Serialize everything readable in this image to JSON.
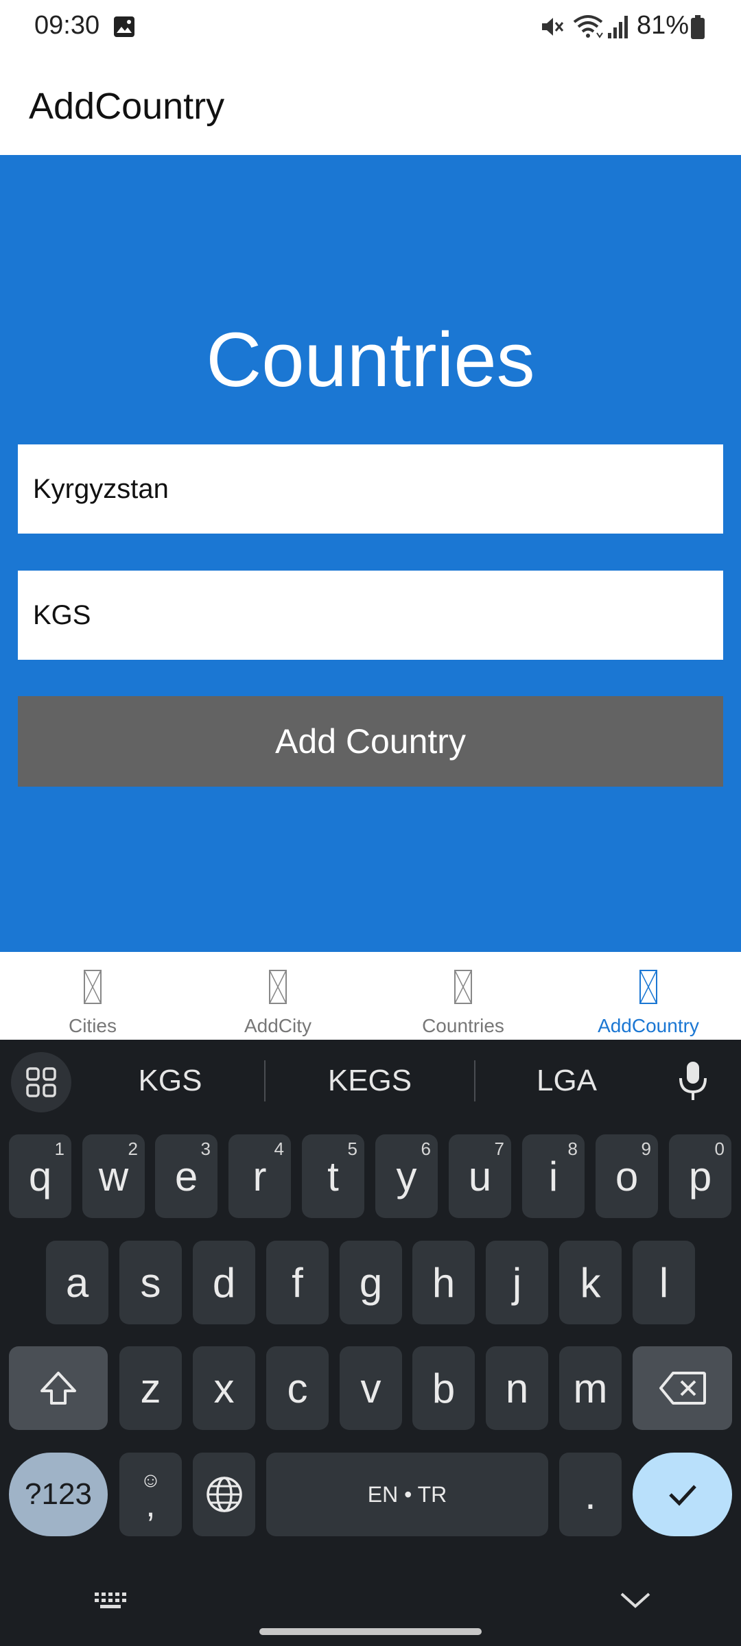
{
  "status_bar": {
    "time": "09:30",
    "battery": "81%",
    "icons": [
      "gallery-icon",
      "mute-icon",
      "wifi-icon",
      "signal-icon",
      "battery-icon"
    ]
  },
  "app_bar": {
    "title": "AddCountry"
  },
  "main": {
    "heading": "Countries",
    "country_name_value": "Kyrgyzstan",
    "currency_value": "KGS",
    "add_button_label": "Add Country"
  },
  "bottom_nav": {
    "tabs": [
      {
        "label": "Cities",
        "active": false
      },
      {
        "label": "AddCity",
        "active": false
      },
      {
        "label": "Countries",
        "active": false
      },
      {
        "label": "AddCountry",
        "active": true
      }
    ]
  },
  "keyboard": {
    "suggestions": [
      "KGS",
      "KEGS",
      "LGA"
    ],
    "row1": [
      {
        "key": "q",
        "hint": "1"
      },
      {
        "key": "w",
        "hint": "2"
      },
      {
        "key": "e",
        "hint": "3"
      },
      {
        "key": "r",
        "hint": "4"
      },
      {
        "key": "t",
        "hint": "5"
      },
      {
        "key": "y",
        "hint": "6"
      },
      {
        "key": "u",
        "hint": "7"
      },
      {
        "key": "i",
        "hint": "8"
      },
      {
        "key": "o",
        "hint": "9"
      },
      {
        "key": "p",
        "hint": "0"
      }
    ],
    "row2": [
      "a",
      "s",
      "d",
      "f",
      "g",
      "h",
      "j",
      "k",
      "l"
    ],
    "row3": [
      "z",
      "x",
      "c",
      "v",
      "b",
      "n",
      "m"
    ],
    "symbols_label": "?123",
    "comma_label": ",",
    "space_label": "EN • TR",
    "period_label": "."
  },
  "colors": {
    "primary": "#1b77d3",
    "button_gray": "#636363",
    "keyboard_bg": "#1b1e22",
    "enter_key": "#b9e0fb"
  }
}
